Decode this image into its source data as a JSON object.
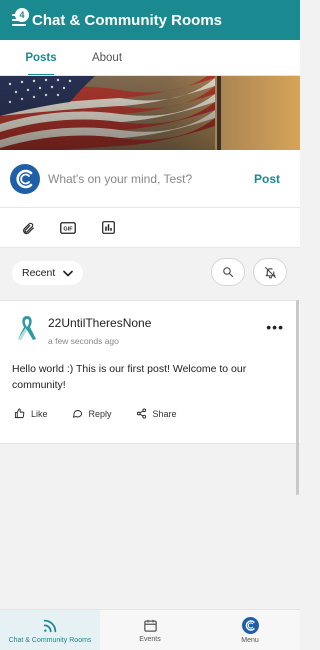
{
  "appbar": {
    "title": "Chat & Community Rooms",
    "menu_badge": "4",
    "menu_icon": "hamburger-icon"
  },
  "tabs": [
    {
      "label": "Posts",
      "active": true
    },
    {
      "label": "About",
      "active": false
    }
  ],
  "composer": {
    "placeholder": "What's on your mind, Test?",
    "post_label": "Post"
  },
  "attachments": [
    {
      "icon": "paperclip-icon"
    },
    {
      "icon": "gif-icon",
      "glyph": "GIF"
    },
    {
      "icon": "poll-icon"
    }
  ],
  "filter": {
    "sort_value": "Recent",
    "search_icon": "search-icon",
    "notification_icon": "bell-off-icon"
  },
  "post": {
    "author": "22UntilTheresNone",
    "time": "a few seconds ago",
    "body": "Hello world :) This is our first post! Welcome to our community!",
    "actions": {
      "like": "Like",
      "reply": "Reply",
      "share": "Share"
    }
  },
  "bottom_nav": [
    {
      "label": "Chat & Community Rooms",
      "icon": "rss-icon",
      "active": true
    },
    {
      "label": "Events",
      "icon": "calendar-icon",
      "active": false
    },
    {
      "label": "Menu",
      "icon": "brand-logo-icon",
      "active": false
    }
  ],
  "colors": {
    "accent": "#1b8a90",
    "brand_blue": "#1f5fa8"
  }
}
